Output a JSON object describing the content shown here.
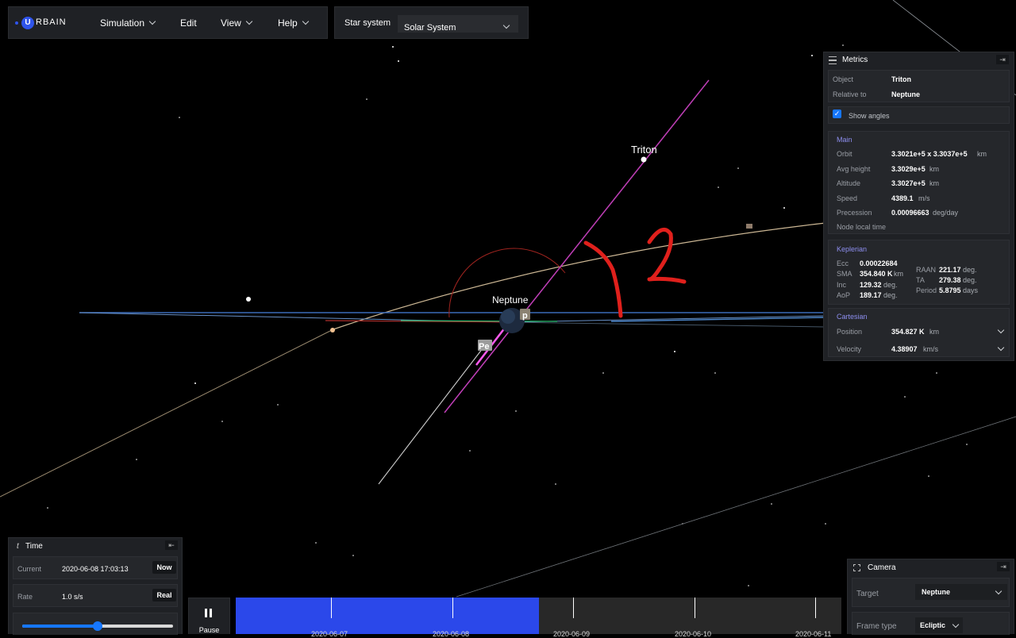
{
  "app": {
    "logo_text": "RBAIN",
    "logo_letter": "U"
  },
  "menu": {
    "simulation": "Simulation",
    "edit": "Edit",
    "view": "View",
    "help": "Help"
  },
  "star_system": {
    "label": "Star system",
    "value": "Solar System"
  },
  "scene": {
    "triton_label": "Triton",
    "neptune_label": "Neptune",
    "pe_label": "Pe",
    "ap_label": "p",
    "annotation": "12"
  },
  "metrics": {
    "title": "Metrics",
    "object_label": "Object",
    "object_value": "Triton",
    "relative_label": "Relative to",
    "relative_value": "Neptune",
    "show_angles": "Show angles",
    "show_angles_checked": true,
    "main": {
      "title": "Main",
      "orbit_label": "Orbit",
      "orbit_value": "3.3021e+5 x 3.3037e+5",
      "orbit_unit": "km",
      "avg_height_label": "Avg height",
      "avg_height_value": "3.3029e+5",
      "avg_height_unit": "km",
      "altitude_label": "Altitude",
      "altitude_value": "3.3027e+5",
      "altitude_unit": "km",
      "speed_label": "Speed",
      "speed_value": "4389.1",
      "speed_unit": "m/s",
      "precession_label": "Precession",
      "precession_value": "0.00096663",
      "precession_unit": "deg/day",
      "node_time_label": "Node local time"
    },
    "keplerian": {
      "title": "Keplerian",
      "ecc_label": "Ecc",
      "ecc_value": "0.00022684",
      "sma_label": "SMA",
      "sma_value": "354.840 K",
      "sma_unit": "km",
      "inc_label": "Inc",
      "inc_value": "129.32",
      "inc_unit": "deg.",
      "aop_label": "AoP",
      "aop_value": "189.17",
      "aop_unit": "deg.",
      "raan_label": "RAAN",
      "raan_value": "221.17",
      "raan_unit": "deg.",
      "ta_label": "TA",
      "ta_value": "279.38",
      "ta_unit": "deg.",
      "period_label": "Period",
      "period_value": "5.8795",
      "period_unit": "days"
    },
    "cartesian": {
      "title": "Cartesian",
      "position_label": "Position",
      "position_value": "354.827 K",
      "position_unit": "km",
      "velocity_label": "Velocity",
      "velocity_value": "4.38907",
      "velocity_unit": "km/s"
    }
  },
  "time": {
    "title": "Time",
    "icon_glyph": "t",
    "current_label": "Current",
    "current_value": "2020-06-08 17:03:13",
    "now_button": "Now",
    "rate_label": "Rate",
    "rate_value": "1.0 s/s",
    "real_button": "Real",
    "rate_slider_fraction": 0.5
  },
  "playback": {
    "pause_label": "Pause"
  },
  "timeline": {
    "progress_fraction": 0.5,
    "ticks": [
      "2020-06-07",
      "2020-06-08",
      "2020-06-09",
      "2020-06-10",
      "2020-06-11"
    ]
  },
  "camera": {
    "title": "Camera",
    "target_label": "Target",
    "target_value": "Neptune",
    "frame_label": "Frame type",
    "frame_value": "Ecliptic"
  }
}
